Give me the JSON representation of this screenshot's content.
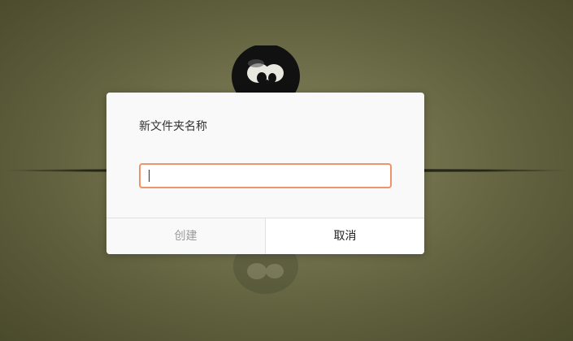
{
  "dialog": {
    "title": "新文件夹名称",
    "input_value": "",
    "create_label": "创建",
    "cancel_label": "取消",
    "input_focus_color": "#f0936b"
  },
  "wallpaper": {
    "icon": "penguin-icon",
    "colors": {
      "center": "#8a8a68",
      "edge": "#4a4a2c"
    }
  }
}
